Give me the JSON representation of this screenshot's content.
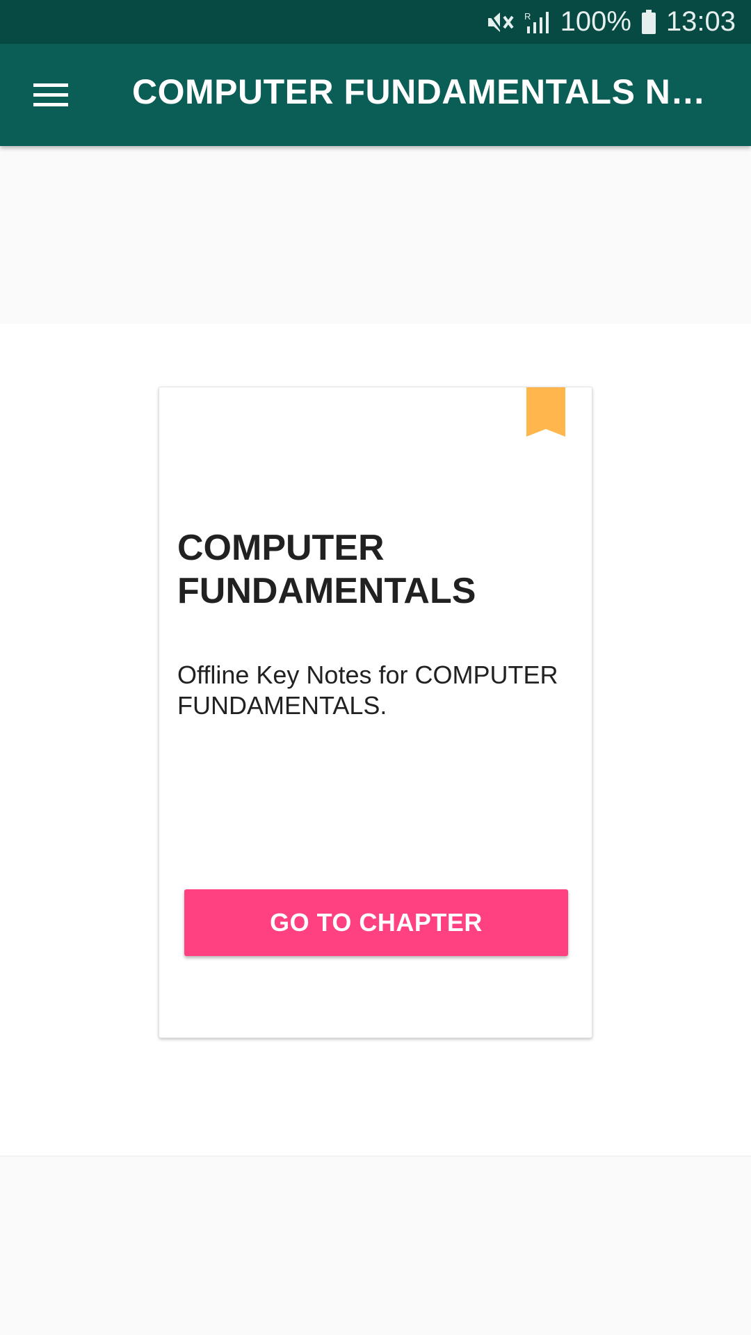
{
  "status_bar": {
    "battery_text": "100%",
    "time": "13:03",
    "icons": [
      "mute-icon",
      "signal-icon",
      "battery-icon"
    ]
  },
  "app_bar": {
    "title": "COMPUTER FUNDAMENTALS NOTES",
    "menu_icon": "hamburger-menu-icon",
    "color": "#0b5e55"
  },
  "card": {
    "bookmark_icon": "bookmark-icon",
    "bookmark_color": "#ffb74d",
    "title": "COMPUTER FUNDAMENTALS",
    "description": "Offline Key Notes for COMPUTER FUNDAMENTALS.",
    "button_label": "GO TO CHAPTER",
    "button_color": "#ff4081"
  }
}
